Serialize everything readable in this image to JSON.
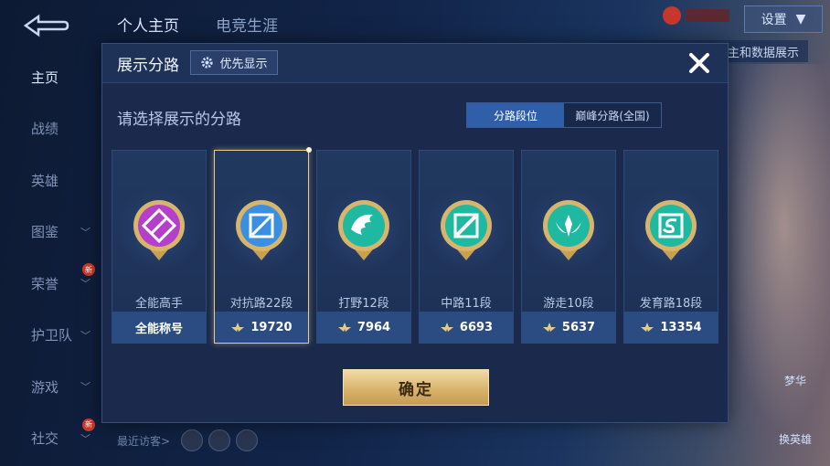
{
  "background": {
    "top_tabs": [
      "个人主页",
      "电竞生涯"
    ],
    "settings_label": "设置",
    "right_banner": "主和数据展示",
    "sidebar": [
      {
        "label": "主页",
        "active": true
      },
      {
        "label": "战绩"
      },
      {
        "label": "英雄"
      },
      {
        "label": "图鉴",
        "chevron": true
      },
      {
        "label": "荣誉",
        "chevron": true,
        "new": true
      },
      {
        "label": "护卫队",
        "chevron": true
      },
      {
        "label": "游戏",
        "chevron": true
      },
      {
        "label": "社交",
        "chevron": true,
        "new": true
      }
    ],
    "new_tag": "新",
    "visitors_label": "最近访客>",
    "right_btn_1": "梦华",
    "right_btn_2": "换英雄"
  },
  "modal": {
    "title": "展示分路",
    "priority_label": "优先显示",
    "prompt": "请选择展示的分路",
    "tabs": [
      {
        "label": "分路段位",
        "active": true
      },
      {
        "label": "巅峰分路(全国)",
        "active": false
      }
    ],
    "cards": [
      {
        "label": "全能高手",
        "footer": "全能称号",
        "badge": "allround-badge-icon",
        "selected": false,
        "has_power": false,
        "color": "#b43fc8"
      },
      {
        "label": "对抗路22段",
        "footer": "19720",
        "badge": "clash-lane-badge-icon",
        "selected": true,
        "has_power": true,
        "color": "#3a8fe0"
      },
      {
        "label": "打野12段",
        "footer": "7964",
        "badge": "jungle-badge-icon",
        "selected": false,
        "has_power": true,
        "color": "#1fb8a0"
      },
      {
        "label": "中路11段",
        "footer": "6693",
        "badge": "mid-lane-badge-icon",
        "selected": false,
        "has_power": true,
        "color": "#1fb8a0"
      },
      {
        "label": "游走10段",
        "footer": "5637",
        "badge": "roam-badge-icon",
        "selected": false,
        "has_power": true,
        "color": "#1fb8a0"
      },
      {
        "label": "发育路18段",
        "footer": "13354",
        "badge": "farm-lane-badge-icon",
        "selected": false,
        "has_power": true,
        "color": "#1fb8a0"
      }
    ],
    "confirm_label": "确定"
  },
  "colors": {
    "modal_bg": "#1b2a4c",
    "active_tab": "#2f5fa8",
    "selected_border": "#e8c98a",
    "confirm_gold": "#d9b46d"
  }
}
